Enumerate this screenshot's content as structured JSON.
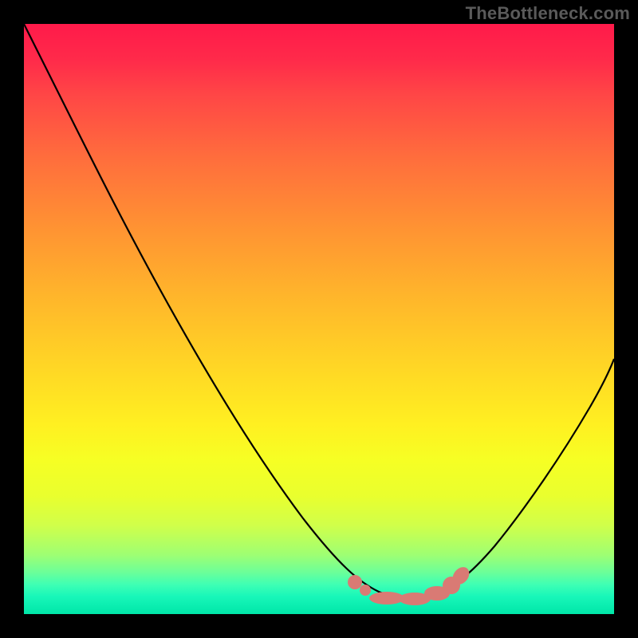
{
  "watermark": "TheBottleneck.com",
  "chart_data": {
    "type": "line",
    "title": "",
    "xlabel": "",
    "ylabel": "",
    "xlim": [
      0,
      100
    ],
    "ylim": [
      0,
      100
    ],
    "series": [
      {
        "name": "bottleneck-curve",
        "x": [
          0,
          5,
          10,
          15,
          20,
          25,
          30,
          35,
          40,
          45,
          50,
          55,
          60,
          62,
          64,
          66,
          68,
          70,
          75,
          80,
          85,
          90,
          95,
          100
        ],
        "y": [
          100,
          97,
          93,
          88,
          82,
          74,
          66,
          57,
          47,
          37,
          27,
          18,
          10,
          6,
          4,
          3,
          3,
          4,
          8,
          14,
          22,
          31,
          40,
          50
        ]
      }
    ],
    "highlight": {
      "name": "optimal-range",
      "x": [
        57,
        58.5,
        60,
        62,
        64,
        66,
        68,
        69.5,
        70.5,
        71.5
      ],
      "y": [
        12,
        9.5,
        7,
        5,
        4,
        3.5,
        4,
        5,
        6.5,
        8.5
      ]
    },
    "background_gradient": {
      "top": "#ff1a4a",
      "mid": "#fff021",
      "bottom": "#00e6a8"
    }
  }
}
